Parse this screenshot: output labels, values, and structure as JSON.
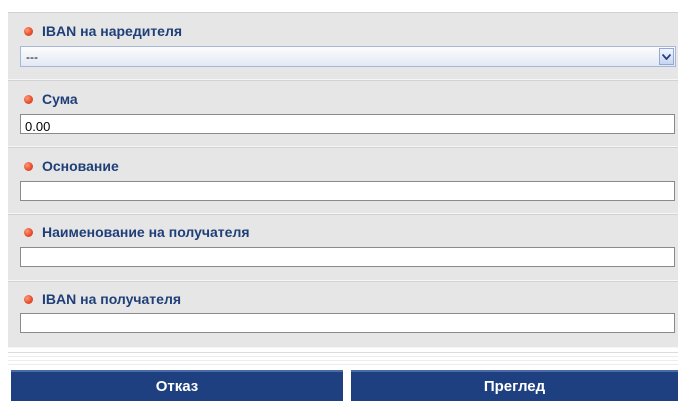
{
  "form": {
    "fields": [
      {
        "label": "IBAN на наредителя",
        "type": "select",
        "value": "---"
      },
      {
        "label": "Сума",
        "type": "text",
        "value": "0.00"
      },
      {
        "label": "Основание",
        "type": "text",
        "value": ""
      },
      {
        "label": "Наименование на получателя",
        "type": "text",
        "value": ""
      },
      {
        "label": "IBAN на получателя",
        "type": "text",
        "value": ""
      }
    ]
  },
  "buttons": {
    "cancel_label": "Отказ",
    "preview_label": "Преглед"
  },
  "colors": {
    "label_text": "#1f3f78",
    "button_bg": "#1f4080",
    "required_bullet": "#e8502f"
  }
}
